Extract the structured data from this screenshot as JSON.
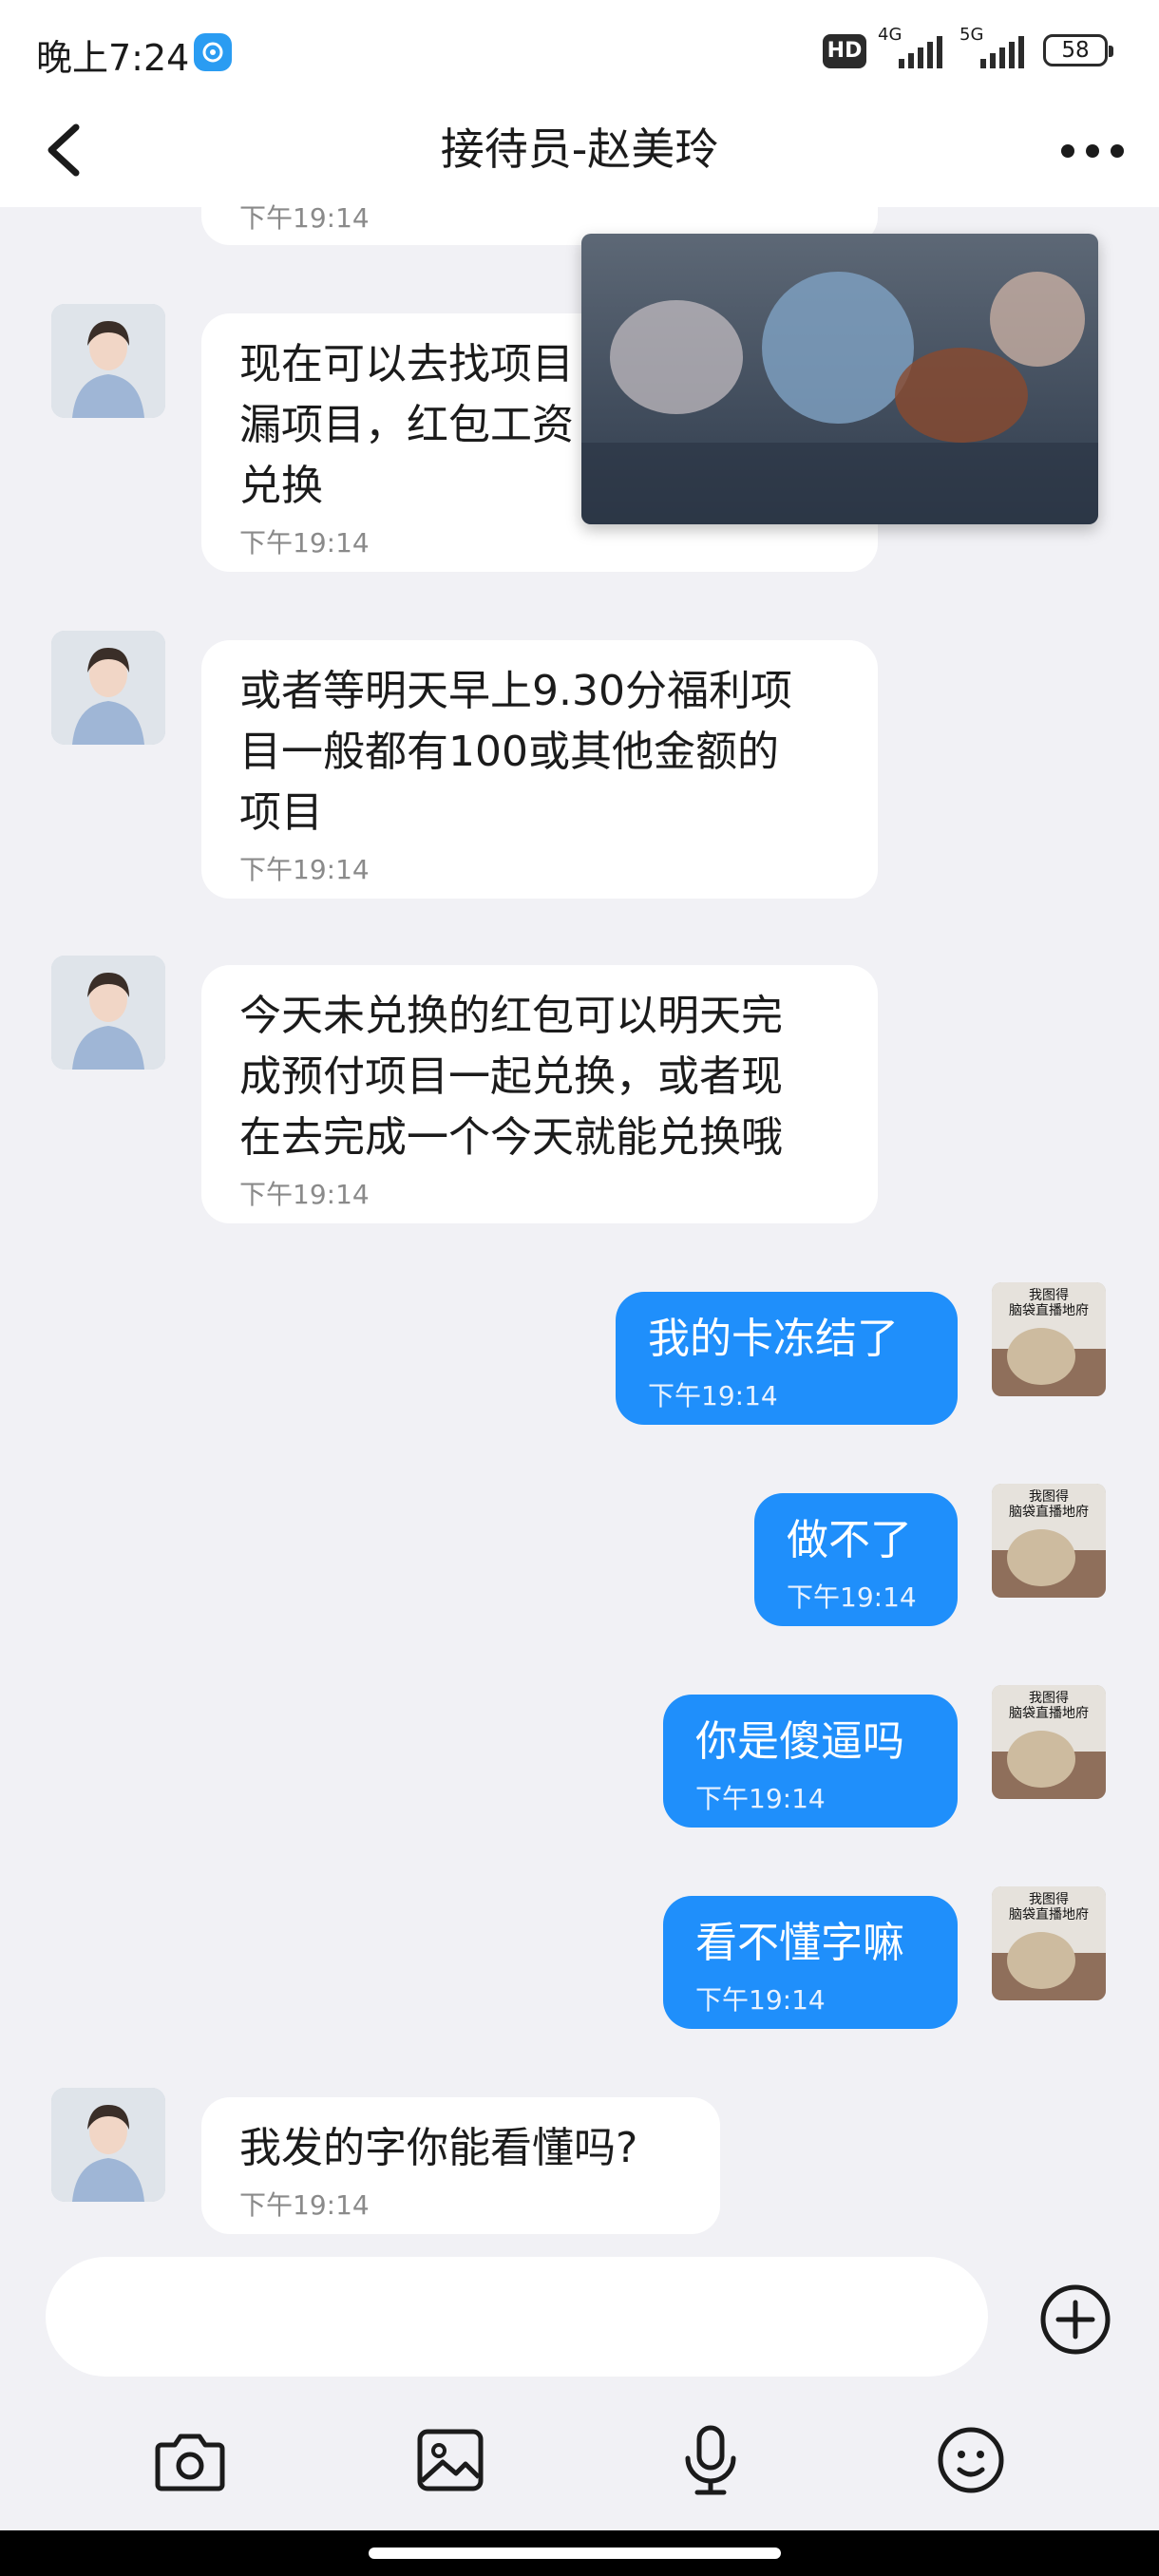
{
  "status_bar": {
    "time": "晚上7:24",
    "hd_label": "HD",
    "net_1": "4G",
    "net_2": "5G",
    "battery": "58"
  },
  "header": {
    "title": "接待员-赵美玲"
  },
  "messages": [
    {
      "side": "left",
      "text": "现在可以去找项目\n漏项目，红包工资\n兑换",
      "time": "下午19:14"
    },
    {
      "side": "left",
      "text": "或者等明天早上9.30分福利项\n目一般都有100或其他金额的\n项目",
      "time": "下午19:14"
    },
    {
      "side": "left",
      "text": "今天未兑换的红包可以明天完\n成预付项目一起兑换，或者现\n在去完成一个今天就能兑换哦",
      "time": "下午19:14"
    },
    {
      "side": "right",
      "text": "我的卡冻结了",
      "time": "下午19:14"
    },
    {
      "side": "right",
      "text": "做不了",
      "time": "下午19:14"
    },
    {
      "side": "right",
      "text": "你是傻逼吗",
      "time": "下午19:14"
    },
    {
      "side": "right",
      "text": "看不懂字嘛",
      "time": "下午19:14"
    },
    {
      "side": "left",
      "text": "我发的字你能看懂吗?",
      "time": "下午19:14"
    }
  ],
  "partial_time": "下午19:14",
  "sticker_text": "我图得\n脑袋直播地府",
  "colors": {
    "accent": "#1f8ffb",
    "background": "#f1f1f5"
  },
  "icons": [
    "back-arrow-icon",
    "more-icon",
    "add-icon",
    "camera-icon",
    "image-icon",
    "microphone-icon",
    "emoji-icon"
  ]
}
